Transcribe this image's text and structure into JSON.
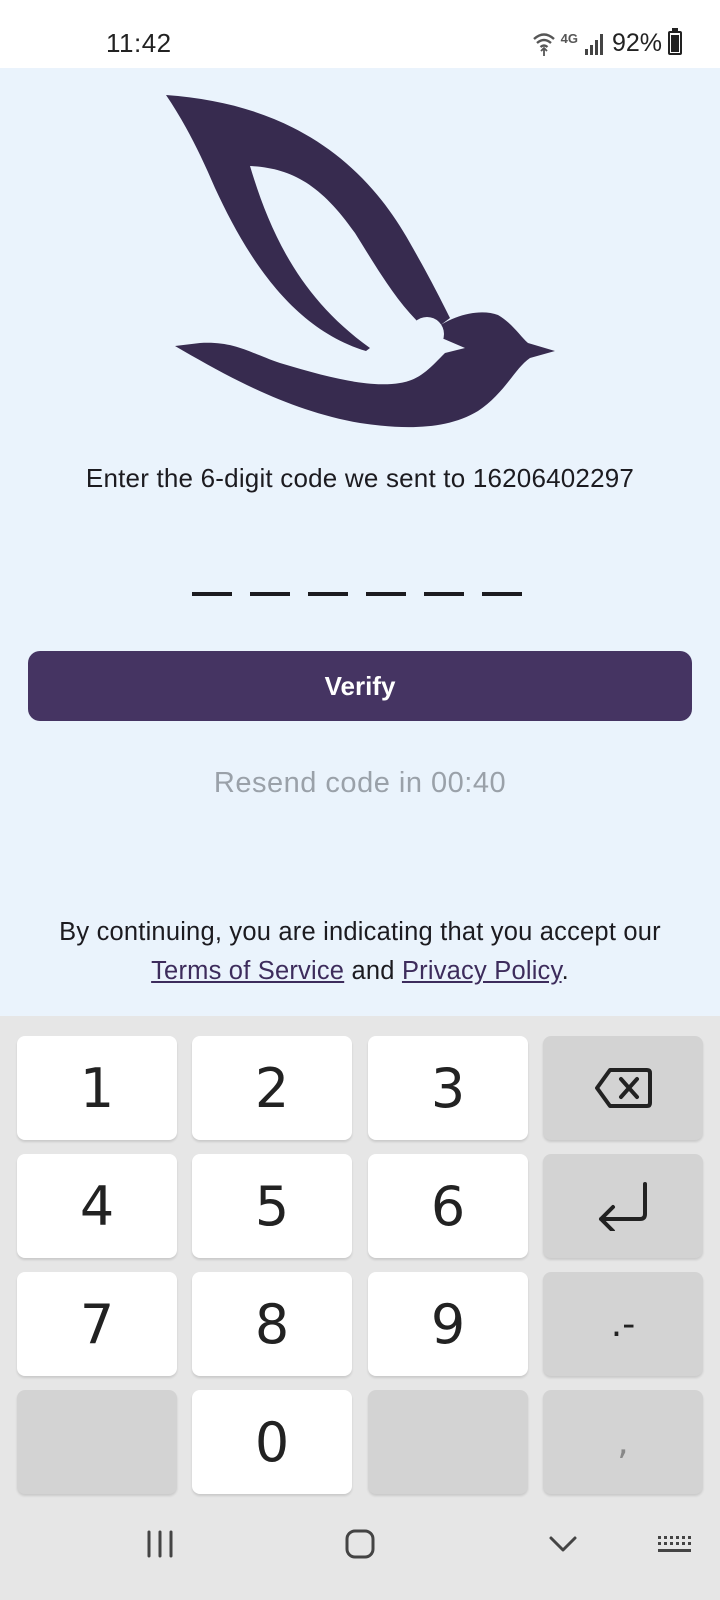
{
  "status_bar": {
    "time": "11:42",
    "battery_percent": "92%",
    "battery_level": 0.92,
    "network": "4G",
    "icons": [
      "wifi-icon",
      "signal-icon",
      "battery-icon"
    ]
  },
  "logo": {
    "icon": "bird-logo-icon",
    "color": "#372b4f"
  },
  "main": {
    "instruction": "Enter the 6-digit code we sent to 16206402297",
    "code_slot_count": 6,
    "verify_label": "Verify",
    "resend_text": "Resend code in 00:40",
    "legal": {
      "prefix": "By continuing, you are indicating that you accept our",
      "terms_link": "Terms of Service",
      "and": "and",
      "privacy_link": "Privacy Policy",
      "suffix": "."
    }
  },
  "keyboard": {
    "keys": {
      "k1": "1",
      "k2": "2",
      "k3": "3",
      "k4": "4",
      "k5": "5",
      "k6": "6",
      "k7": "7",
      "k8": "8",
      "k9": "9",
      "k0": "0",
      "dot_dash": ".-",
      "comma": ","
    },
    "icons": [
      "backspace-icon",
      "enter-icon"
    ]
  },
  "nav_bar": {
    "icons": [
      "recent-apps-icon",
      "home-icon",
      "back-icon",
      "keyboard-switch-icon"
    ]
  },
  "colors": {
    "accent": "#453462",
    "background": "#eaf3fc",
    "muted_text": "#9aa1a9",
    "keyboard_bg": "#e6e6e6"
  }
}
